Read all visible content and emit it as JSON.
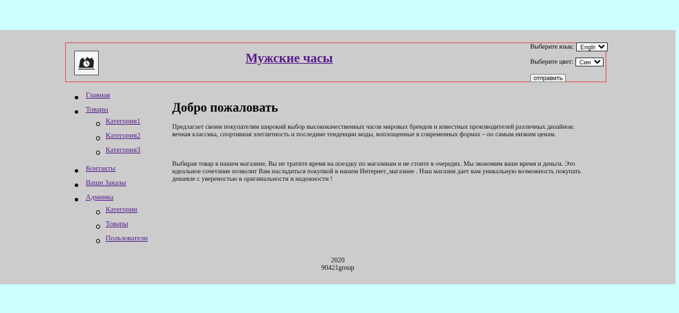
{
  "header": {
    "site_title": "Мужские часы",
    "language_label": "Выберите язык:",
    "language_value": "English",
    "color_label": "Выберите цвет:",
    "color_value": "Синий",
    "submit_label": "отправить"
  },
  "nav": {
    "home": "Главная",
    "products": "Товары",
    "products_children": [
      "Категория1",
      "Категория2",
      "Категория3"
    ],
    "contacts": "Контакты",
    "orders": "Ваши Заказы",
    "admin": "Админка",
    "admin_children": [
      "Категории",
      "Товары",
      "Пользователи"
    ]
  },
  "main": {
    "title": "Добро пожаловать",
    "paragraph1": "Предлагает своим покупателям широкий выбор высококачественных часов мировых брендов и известных производителей различных дизайнов: вечная классика, спортивная элегантность и последние тенденции моды, воплощенные в современных формах – по самым низким ценам.",
    "paragraph2": "Выбирая товар в нашем магазине, Вы не тратите время на поездку по магазинам и не стоите в очередях. Мы экономим ваше время и деньги. Это идеальное сочетание позволит Вам насладиться покупкой в нашем Интернет_магазине . Наш магазин дает вам уникальную возможность покупать дешевле с увереностью в оригинальности и надежности !"
  },
  "footer": {
    "year": "2020",
    "group": "90421group"
  },
  "colors": {
    "outer_bg": "#ccffff",
    "page_bg": "#cccccc",
    "link": "#551a8b",
    "header_border": "#e05050"
  },
  "icons": {
    "logo": "watch-logo-icon"
  }
}
